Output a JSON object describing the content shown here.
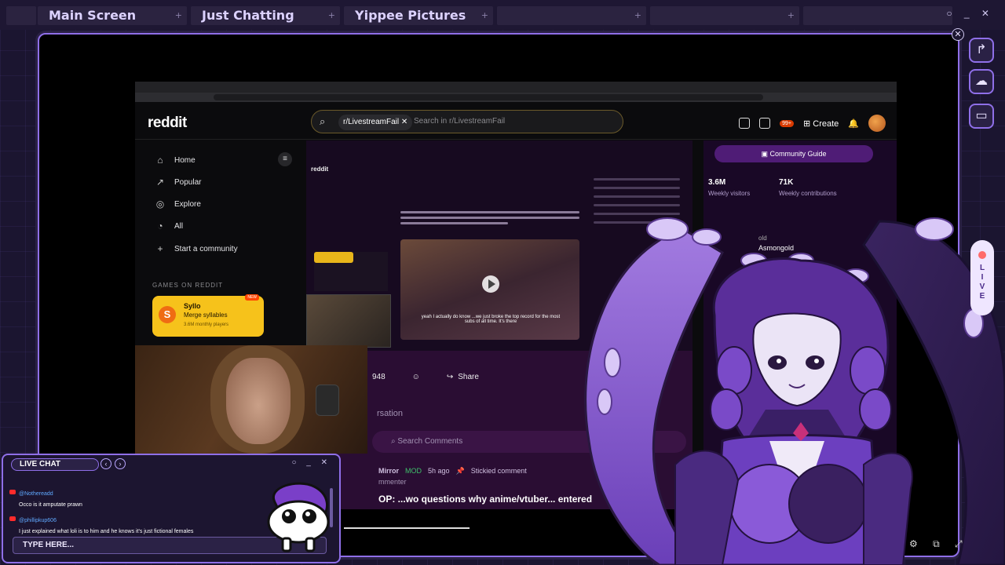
{
  "tabs": [
    {
      "label": "Main Screen"
    },
    {
      "label": "Just Chatting"
    },
    {
      "label": "Yippee Pictures"
    },
    {
      "label": ""
    },
    {
      "label": ""
    },
    {
      "label": ""
    }
  ],
  "window_controls": "○ _ ✕",
  "reddit": {
    "logo": "reddit",
    "search_chip": "r/LivestreamFail",
    "search_placeholder": "Search in r/LivestreamFail",
    "create_label": "Create",
    "notif_badge": "99+",
    "nav": [
      {
        "icon": "⌂",
        "label": "Home"
      },
      {
        "icon": "↗",
        "label": "Popular"
      },
      {
        "icon": "◎",
        "label": "Explore"
      },
      {
        "icon": "◔",
        "label": "All"
      },
      {
        "icon": "+",
        "label": "Start a community"
      }
    ],
    "games_section": "GAMES ON REDDIT",
    "game": {
      "logo": "S",
      "title": "Syllo",
      "subtitle": "Merge syllables",
      "players": "3.6M monthly players",
      "badge": "NEW"
    },
    "post": {
      "video_caption": "yeah I actually do know ...we just broke the top record for the most subs of all time. It's there",
      "nested_logo": "reddit",
      "upvotes": "948",
      "share_label": "Share",
      "conversation": "rsation",
      "search_comments": "Search Comments",
      "comment_author": "Mirror",
      "comment_mod": "MOD",
      "comment_time": "5h ago",
      "comment_sticky": "Stickied comment",
      "commenter_label": "mmenter",
      "comment_text": "OP: ...wo questions why anime/vtuber... entered"
    },
    "sidebar": {
      "guide_label": "Community Guide",
      "stats": [
        {
          "num": "3.6M",
          "label": "Weekly visitors"
        },
        {
          "num": "71K",
          "label": "Weekly contributions"
        }
      ],
      "mod_gold": "old",
      "mod_name": "Asmongold"
    }
  },
  "side_icons": [
    {
      "name": "share-arrow-icon",
      "glyph": "↱"
    },
    {
      "name": "sticker-icon",
      "glyph": "☁"
    },
    {
      "name": "bookmark-icon",
      "glyph": "▭"
    }
  ],
  "live_pill": {
    "letters": [
      "L",
      "I",
      "V",
      "E"
    ]
  },
  "chat": {
    "title": "LIVE CHAT",
    "controls": "○ _ ✕",
    "messages": [
      {
        "user": "@Nothereadd",
        "text": "Occo is it amputate prawn"
      },
      {
        "user": "@phillipkup606",
        "text": "I just explained what loli is to him and he knows it's just fictional females"
      }
    ],
    "input_placeholder": "TYPE HERE..."
  },
  "player_controls": "⚙ ⧉ ⤢",
  "colors": {
    "accent": "#8f6fe8",
    "background": "#1b1530",
    "reddit_purple": "#2a0d33",
    "live_red": "#ff6a6a"
  }
}
